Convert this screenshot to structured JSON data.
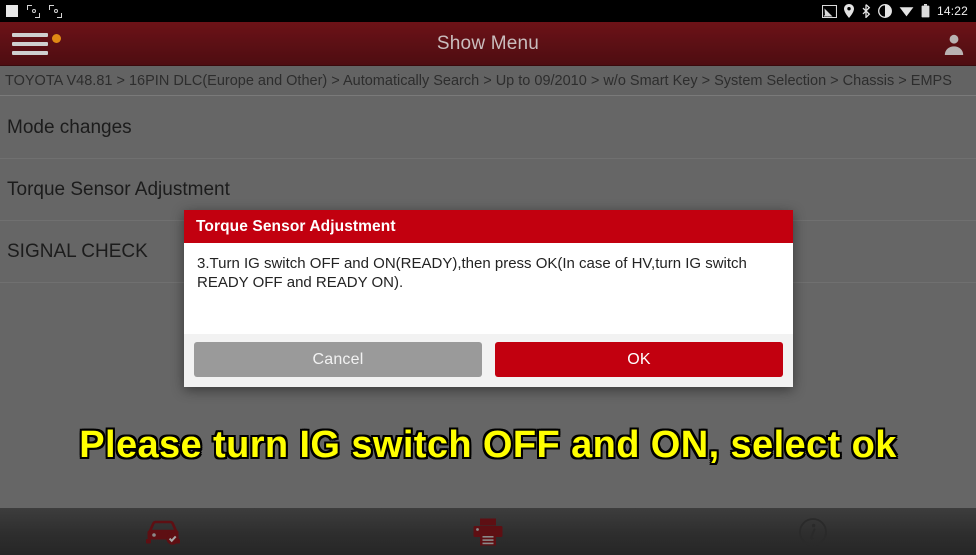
{
  "status_bar": {
    "time": "14:22",
    "notification_icons": [
      "blank-notification-icon",
      "screenshot-crop-icon",
      "screenshot-crop-icon"
    ],
    "system_icons": [
      "screencast-icon",
      "location-pin-icon",
      "bluetooth-icon",
      "do-not-disturb-icon",
      "wifi-icon",
      "battery-icon"
    ]
  },
  "title_bar": {
    "menu_icon": "hamburger-menu-icon",
    "badge": "notification-dot",
    "title": "Show Menu",
    "avatar_icon": "user-avatar-icon",
    "background_color": "#5e1015"
  },
  "breadcrumb": {
    "text": "TOYOTA V48.81 > 16PIN DLC(Europe and Other) > Automatically Search > Up to 09/2010 > w/o Smart Key > System Selection > Chassis > EMPS"
  },
  "menu": {
    "items": [
      {
        "label": "Mode changes"
      },
      {
        "label": "Torque Sensor Adjustment"
      },
      {
        "label": "SIGNAL CHECK"
      }
    ]
  },
  "dialog": {
    "title": "Torque Sensor Adjustment",
    "message": "3.Turn IG switch OFF and ON(READY),then press OK(In case of HV,turn IG switch READY OFF and READY ON).",
    "cancel_label": "Cancel",
    "ok_label": "OK",
    "title_color": "#c2000f",
    "ok_color": "#c2000f",
    "cancel_color": "#9a9a9a"
  },
  "caption": {
    "text": "Please turn IG switch OFF and ON, select ok",
    "fill_color": "#ffff00",
    "stroke_color": "#000000"
  },
  "bottom_bar": {
    "buttons": [
      {
        "icon": "car-check-icon"
      },
      {
        "icon": "printer-icon"
      },
      {
        "icon": "info-icon"
      }
    ]
  }
}
